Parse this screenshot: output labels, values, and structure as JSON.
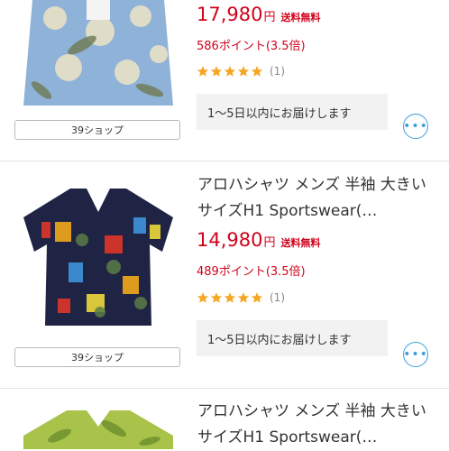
{
  "products": [
    {
      "title": "",
      "price": "17,980",
      "yen": "円",
      "shipping": "送料無料",
      "points": "586ポイント(3.5倍)",
      "rating": 5,
      "review_count": "(1)",
      "delivery": "1〜5日以内にお届けします",
      "shop": "39ショップ",
      "more_icon": "more-icon"
    },
    {
      "title": "アロハシャツ メンズ 半袖 大きいサイズH1 Sportswear(…",
      "price": "14,980",
      "yen": "円",
      "shipping": "送料無料",
      "points": "489ポイント(3.5倍)",
      "rating": 5,
      "review_count": "(1)",
      "delivery": "1〜5日以内にお届けします",
      "shop": "39ショップ",
      "more_icon": "more-icon"
    },
    {
      "title": "アロハシャツ メンズ 半袖 大きいサイズH1 Sportswear(…"
    }
  ],
  "colors": {
    "price": "#d0021b",
    "star": "#f5a623",
    "accent": "#3aa0dc"
  }
}
